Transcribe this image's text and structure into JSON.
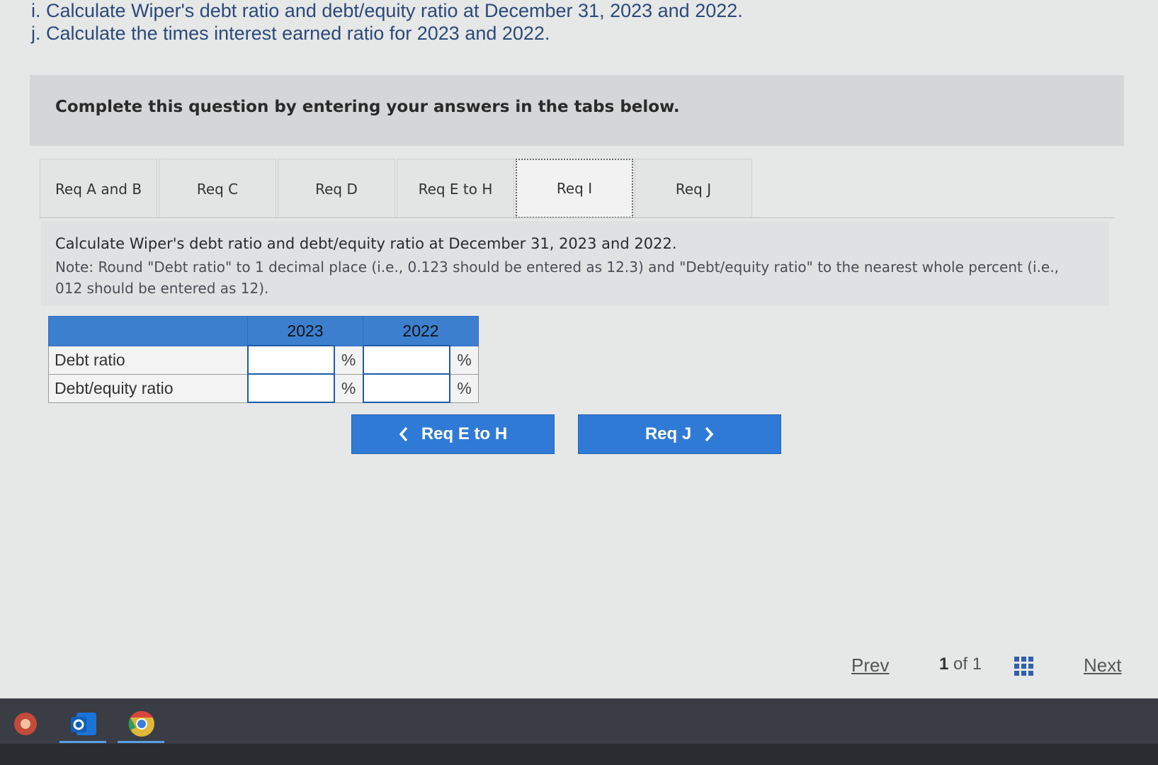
{
  "question": {
    "line_i": "i. Calculate Wiper's debt ratio and debt/equity ratio at December 31, 2023 and 2022.",
    "line_j": "j. Calculate the times interest earned ratio for 2023 and 2022."
  },
  "instructions": "Complete this question by entering your answers in the tabs below.",
  "tabs": [
    {
      "label": "Req A and B"
    },
    {
      "label": "Req C"
    },
    {
      "label": "Req D"
    },
    {
      "label": "Req E to H"
    },
    {
      "label": "Req I",
      "active": true
    },
    {
      "label": "Req J"
    }
  ],
  "panel": {
    "prompt": "Calculate Wiper's debt ratio and debt/equity ratio at December 31, 2023 and 2022.",
    "note": "Note: Round \"Debt ratio\" to 1 decimal place (i.e., 0.123 should be entered as 12.3) and \"Debt/equity ratio\" to the nearest whole percent (i.e., 012 should be entered as 12)."
  },
  "table": {
    "columns": [
      "2023",
      "2022"
    ],
    "rows": [
      {
        "label": "Debt ratio",
        "unit": "%"
      },
      {
        "label": "Debt/equity ratio",
        "unit": "%"
      }
    ]
  },
  "buttons": {
    "prev_label": "Req E to H",
    "next_label": "Req J"
  },
  "footer": {
    "prev": "Prev",
    "page_current": "1",
    "page_of": "of",
    "page_total": "1",
    "next": "Next"
  },
  "icons": {
    "accent": "#2f7ad6",
    "header_blue": "#3d7fcf"
  }
}
